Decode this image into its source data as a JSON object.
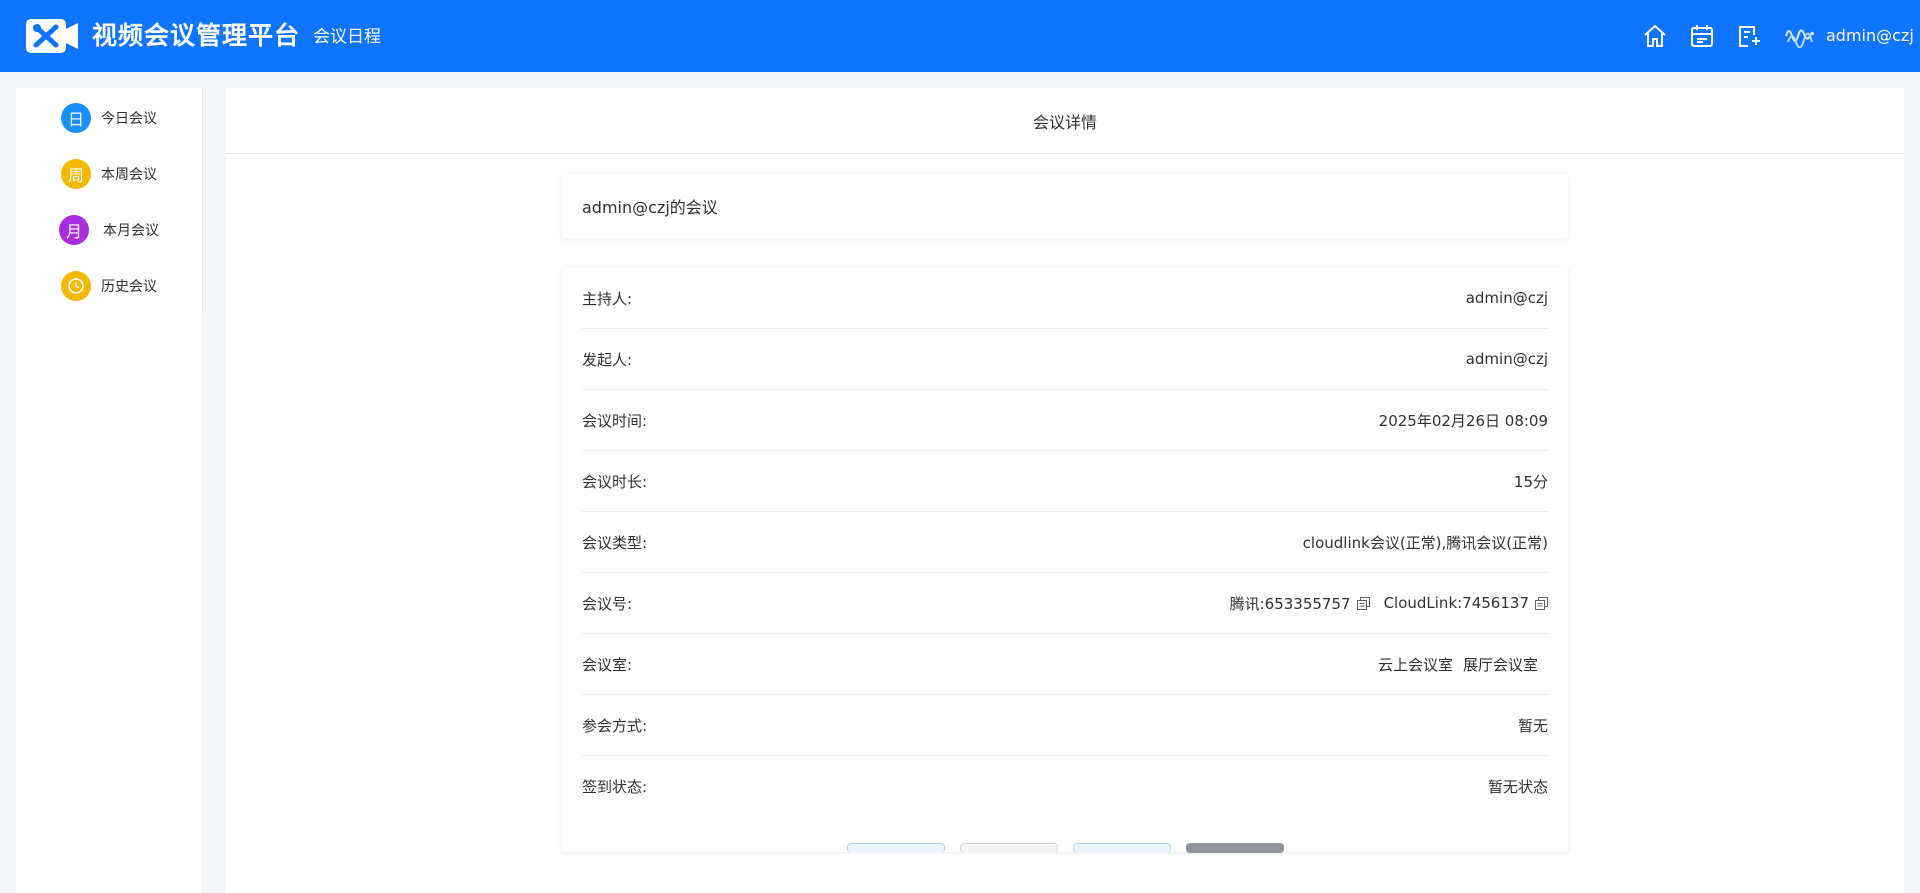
{
  "header": {
    "app_title": "视频会议管理平台",
    "nav_link": "会议日程",
    "user": "admin@czj",
    "icons": [
      "home-icon",
      "calendar-icon",
      "document-edit-icon"
    ]
  },
  "sidebar": {
    "items": [
      {
        "badge": "日",
        "label": "今日会议",
        "color": "#1890ff"
      },
      {
        "badge": "周",
        "label": "本周会议",
        "color": "#f5b800"
      },
      {
        "badge": "月",
        "label": "本月会议",
        "color": "#a72de0"
      },
      {
        "badge": "",
        "label": "历史会议",
        "color": "#f5b800"
      }
    ]
  },
  "main": {
    "title": "会议详情",
    "meeting_name": "admin@czj的会议",
    "details": [
      {
        "label": "主持人:",
        "value": "admin@czj"
      },
      {
        "label": "发起人:",
        "value": "admin@czj"
      },
      {
        "label": "会议时间:",
        "value": "2025年02月26日 08:09"
      },
      {
        "label": "会议时长:",
        "value": "15分"
      },
      {
        "label": "会议类型:",
        "value": "cloudlink会议(正常),腾讯会议(正常)"
      },
      {
        "label": "会议号:",
        "tencent": "腾讯:653355757",
        "cloudlink": "CloudLink:7456137"
      },
      {
        "label": "会议室:",
        "rooms": [
          "云上会议室",
          "展厅会议室"
        ]
      },
      {
        "label": "参会方式:",
        "value": "暂无"
      },
      {
        "label": "签到状态:",
        "value": "暂无状态"
      }
    ]
  },
  "colors": {
    "header_bg": "#0f74ff",
    "page_bg": "#f5f6f8"
  }
}
